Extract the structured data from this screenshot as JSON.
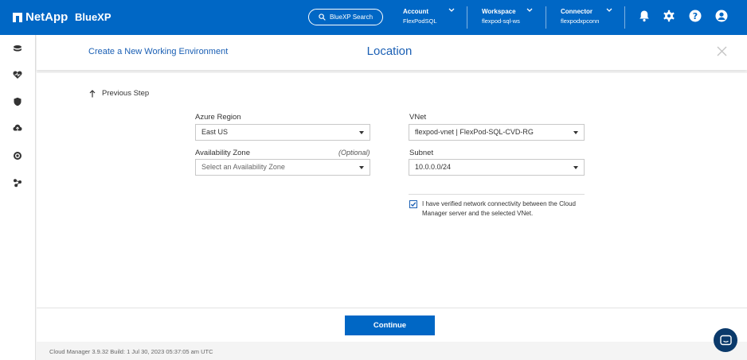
{
  "topbar": {
    "brand": "NetApp",
    "product": "BlueXP",
    "search_label": "BlueXP Search",
    "account": {
      "label": "Account",
      "value": "FlexPodSQL"
    },
    "workspace": {
      "label": "Workspace",
      "value": "flexpod-sql-ws"
    },
    "connector": {
      "label": "Connector",
      "value": "flexpodxpconn"
    },
    "icons": [
      "bell-icon",
      "gear-icon",
      "help-icon",
      "user-icon"
    ],
    "color": "#0067c5"
  },
  "sidebar": {
    "icons": [
      "storage-icon",
      "health-icon",
      "protection-icon",
      "mobility-icon",
      "governance-icon",
      "extensions-icon"
    ]
  },
  "wizard": {
    "breadcrumb": "Create a New Working Environment",
    "title": "Location",
    "previous_step": "Previous Step"
  },
  "form": {
    "azure_region": {
      "label": "Azure Region",
      "value": "East US"
    },
    "availability_zone": {
      "label": "Availability Zone",
      "optional": "(Optional)",
      "placeholder": "Select an Availability Zone"
    },
    "vnet": {
      "label": "VNet",
      "value": "flexpod-vnet | FlexPod-SQL-CVD-RG"
    },
    "subnet": {
      "label": "Subnet",
      "value": "10.0.0.0/24"
    },
    "verify": {
      "checked": true,
      "text": "I have verified network connectivity between the Cloud Manager server and the selected VNet."
    }
  },
  "footer": {
    "continue_label": "Continue",
    "status": "Cloud Manager 3.9.32    Build: 1    Jul 30, 2023 05:37:05 am UTC"
  }
}
